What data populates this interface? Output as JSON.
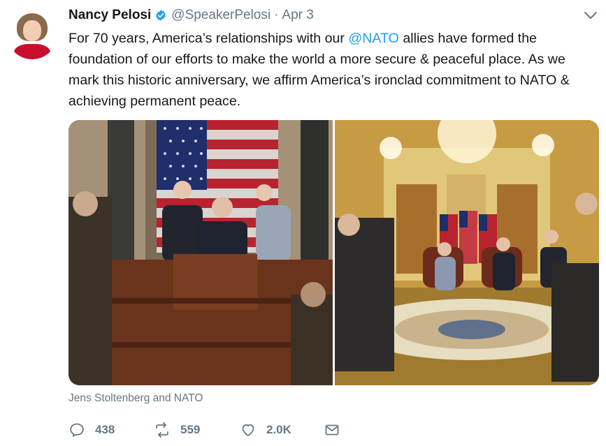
{
  "tweet": {
    "author_name": "Nancy Pelosi",
    "handle": "@SpeakerPelosi",
    "separator": "·",
    "date": "Apr 3",
    "text_before": "For 70 years, America’s relationships with our ",
    "mention": "@NATO",
    "text_after": " allies have formed the foundation of our efforts to make the world a more secure & peaceful place. As we mark this historic anniversary, we affirm America’s ironclad commitment to NATO & achieving permanent peace.",
    "media_caption": "Jens Stoltenberg and NATO"
  },
  "actions": {
    "reply_count": "438",
    "retweet_count": "559",
    "like_count": "2.0K"
  },
  "icons": {
    "verified": "verified-badge-icon",
    "caret": "chevron-down-icon",
    "reply": "reply-icon",
    "retweet": "retweet-icon",
    "like": "heart-icon",
    "message": "direct-message-icon"
  },
  "colors": {
    "link": "#1da1f2",
    "muted": "#657786",
    "text": "#14171a"
  }
}
